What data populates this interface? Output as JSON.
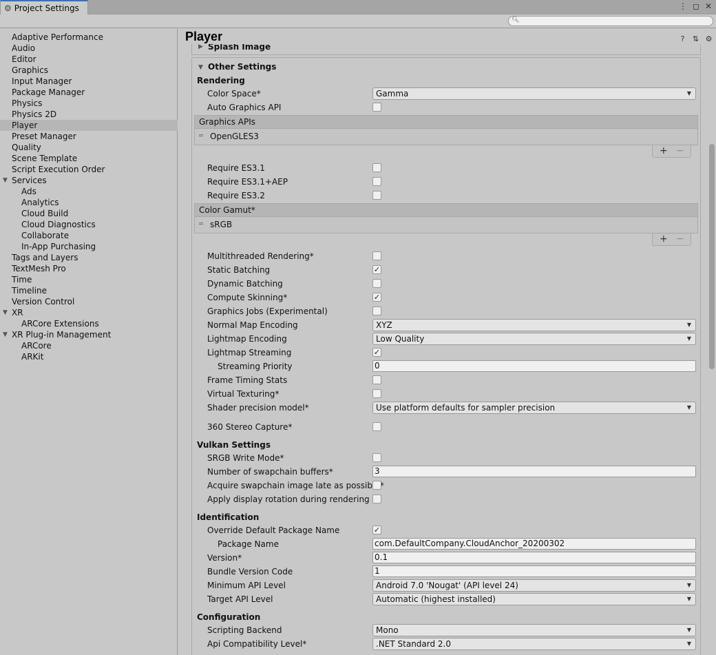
{
  "window": {
    "title": "Project Settings",
    "controls": [
      "⋮",
      "◻",
      "✕"
    ]
  },
  "search": {
    "placeholder": ""
  },
  "sidebar": {
    "items": [
      {
        "label": "Adaptive Performance"
      },
      {
        "label": "Audio"
      },
      {
        "label": "Editor"
      },
      {
        "label": "Graphics"
      },
      {
        "label": "Input Manager"
      },
      {
        "label": "Package Manager"
      },
      {
        "label": "Physics"
      },
      {
        "label": "Physics 2D"
      },
      {
        "label": "Player",
        "selected": true
      },
      {
        "label": "Preset Manager"
      },
      {
        "label": "Quality"
      },
      {
        "label": "Scene Template"
      },
      {
        "label": "Script Execution Order"
      },
      {
        "label": "Services",
        "expanded": true
      },
      {
        "label": "Ads"
      },
      {
        "label": "Analytics"
      },
      {
        "label": "Cloud Build"
      },
      {
        "label": "Cloud Diagnostics"
      },
      {
        "label": "Collaborate"
      },
      {
        "label": "In-App Purchasing"
      },
      {
        "label": "Tags and Layers"
      },
      {
        "label": "TextMesh Pro"
      },
      {
        "label": "Time"
      },
      {
        "label": "Timeline"
      },
      {
        "label": "Version Control"
      },
      {
        "label": "XR",
        "expanded": true
      },
      {
        "label": "ARCore Extensions"
      },
      {
        "label": "XR Plug-in Management",
        "expanded": true
      },
      {
        "label": "ARCore"
      },
      {
        "label": "ARKit"
      }
    ]
  },
  "main": {
    "title": "Player",
    "splash_label": "Splash Image",
    "other_settings_label": "Other Settings",
    "rendering": {
      "header": "Rendering",
      "color_space_label": "Color Space*",
      "color_space_value": "Gamma",
      "auto_graphics_api_label": "Auto Graphics API",
      "auto_graphics_api": false,
      "graphics_apis_header": "Graphics APIs",
      "graphics_apis_item": "OpenGLES3",
      "require_es31_label": "Require ES3.1",
      "require_es31aep_label": "Require ES3.1+AEP",
      "require_es32_label": "Require ES3.2",
      "color_gamut_header": "Color Gamut*",
      "color_gamut_item": "sRGB",
      "multithreaded_label": "Multithreaded Rendering*",
      "static_batching_label": "Static Batching",
      "dynamic_batching_label": "Dynamic Batching",
      "compute_skinning_label": "Compute Skinning*",
      "graphics_jobs_label": "Graphics Jobs (Experimental)",
      "normal_map_label": "Normal Map Encoding",
      "normal_map_value": "XYZ",
      "lightmap_encoding_label": "Lightmap Encoding",
      "lightmap_encoding_value": "Low Quality",
      "lightmap_streaming_label": "Lightmap Streaming",
      "streaming_priority_label": "Streaming Priority",
      "streaming_priority_value": "0",
      "frame_timing_label": "Frame Timing Stats",
      "virtual_texturing_label": "Virtual Texturing*",
      "shader_precision_label": "Shader precision model*",
      "shader_precision_value": "Use platform defaults for sampler precision",
      "stereo_capture_label": "360 Stereo Capture*"
    },
    "vulkan": {
      "header": "Vulkan Settings",
      "srgb_write_label": "SRGB Write Mode*",
      "swapchain_buffers_label": "Number of swapchain buffers*",
      "swapchain_buffers_value": "3",
      "acquire_late_label": "Acquire swapchain image late as possible*",
      "display_rotation_label": "Apply display rotation during rendering"
    },
    "identification": {
      "header": "Identification",
      "override_package_label": "Override Default Package Name",
      "package_name_label": "Package Name",
      "package_name_value": "com.DefaultCompany.CloudAnchor_20200302",
      "version_label": "Version*",
      "version_value": "0.1",
      "bundle_code_label": "Bundle Version Code",
      "bundle_code_value": "1",
      "min_api_label": "Minimum API Level",
      "min_api_value": "Android 7.0 'Nougat' (API level 24)",
      "target_api_label": "Target API Level",
      "target_api_value": "Automatic (highest installed)"
    },
    "configuration": {
      "header": "Configuration",
      "scripting_backend_label": "Scripting Backend",
      "scripting_backend_value": "Mono",
      "api_compat_label": "Api Compatibility Level*",
      "api_compat_value": ".NET Standard 2.0"
    }
  },
  "checkboxes": {
    "static_batching": true,
    "compute_skinning": true,
    "lightmap_streaming": true,
    "override_package": true
  },
  "icons": {
    "check": "✓",
    "help": "?",
    "presets": "⇅",
    "settings": "⚙"
  }
}
